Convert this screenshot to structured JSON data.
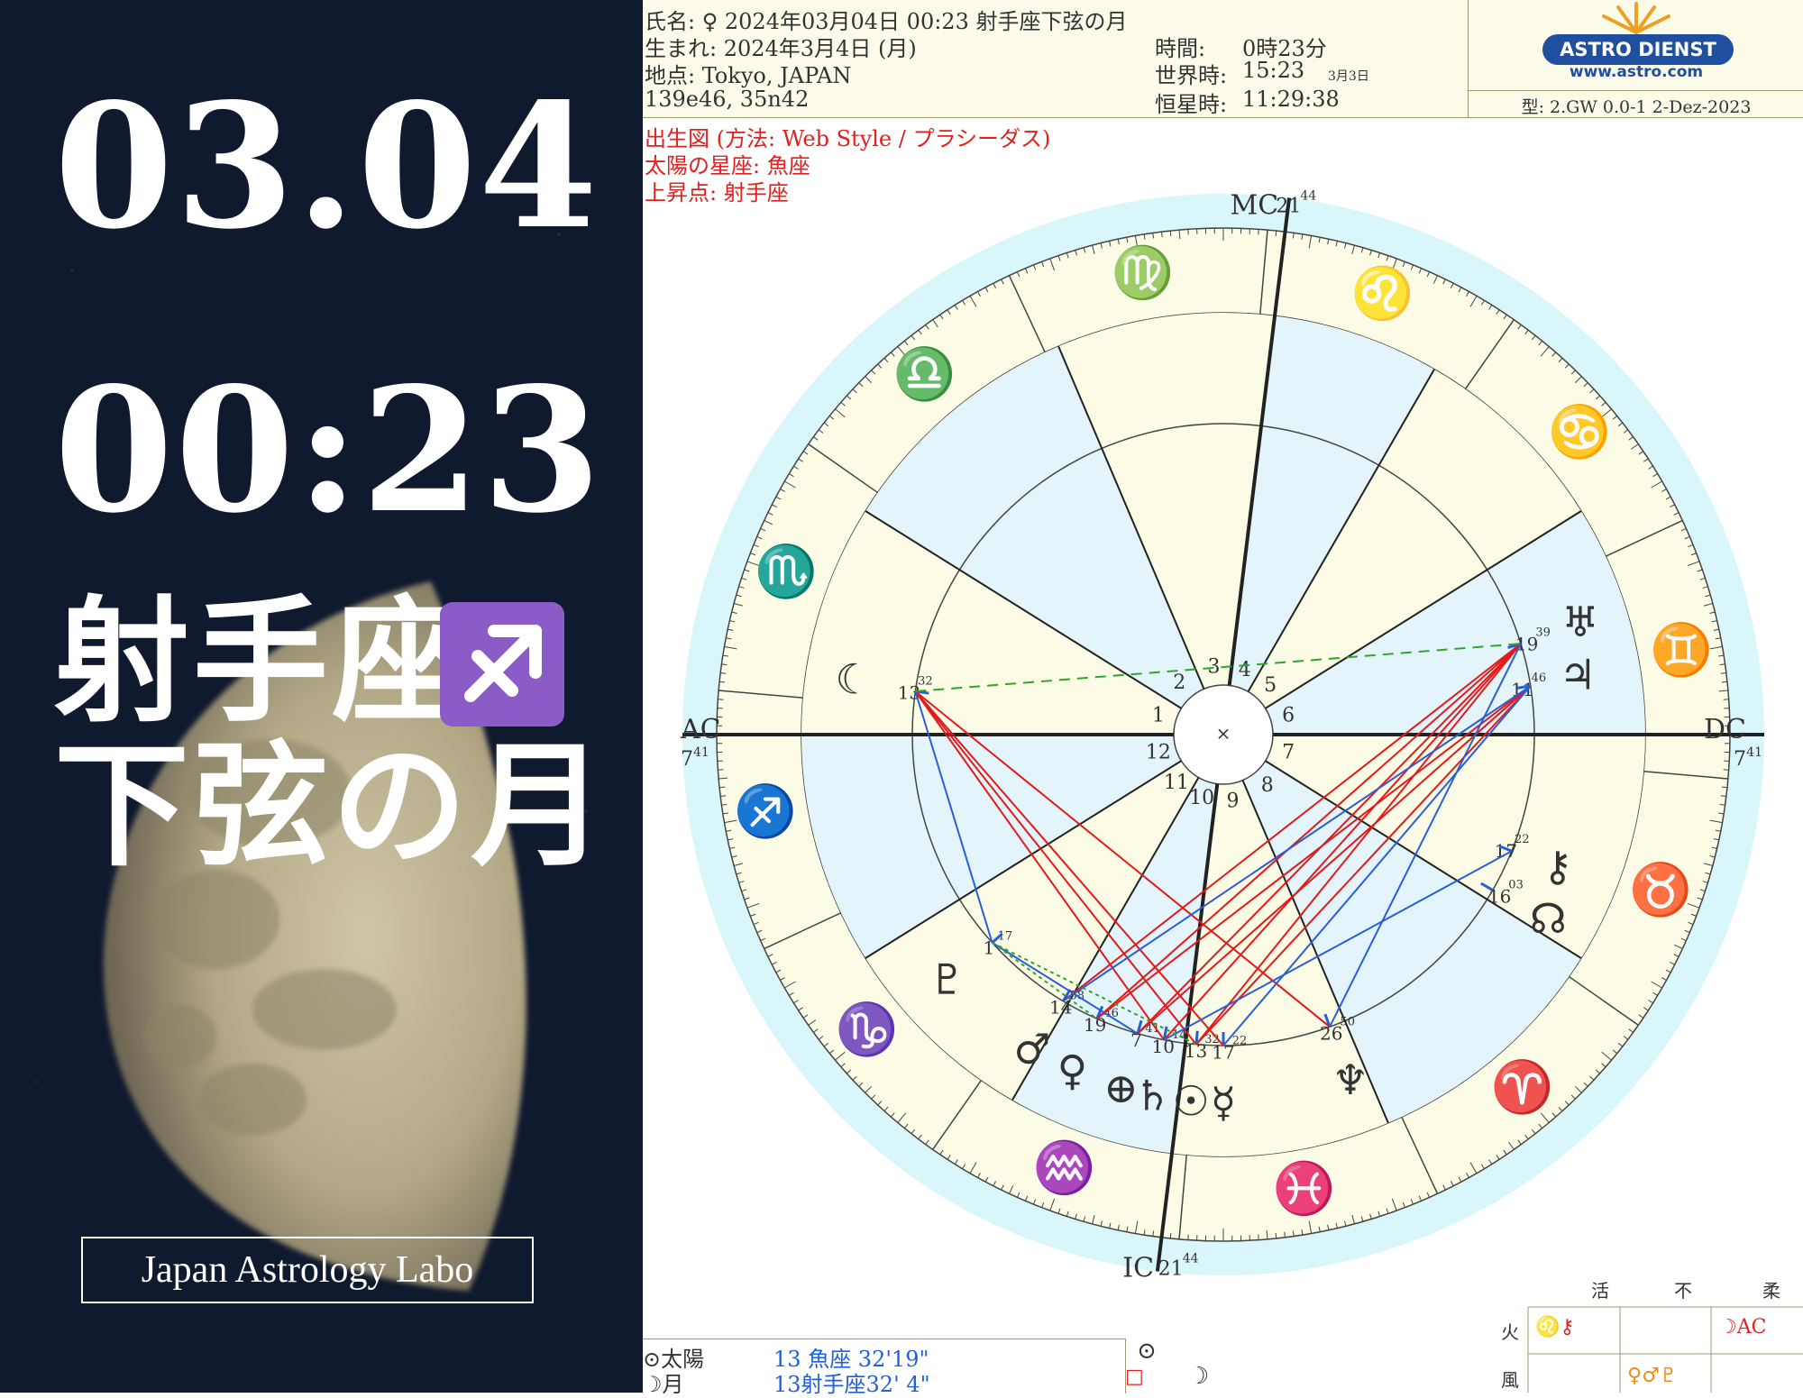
{
  "left_panel": {
    "date": "03.04",
    "time": "00:23",
    "sign": "射手座",
    "sign_symbol": "♐",
    "phase": "下弦の月",
    "brand": "Japan Astrology Labo"
  },
  "header": {
    "name_line": "氏名: ♀ 2024年03月04日 00:23 射手座下弦の月",
    "born_line": "生まれ: 2024年3月4日 (月)",
    "place_line": "地点: Tokyo, JAPAN",
    "coords_line": "139e46, 35n42",
    "time_label": "時間:",
    "time_value": "0時23分",
    "ut_label": "世界時:",
    "ut_value": "15:23",
    "ut_date": "3月3日",
    "st_label": "恒星時:",
    "st_value": "11:29:38",
    "logo_text": "ASTRO DIENST",
    "logo_url": "www.astro.com",
    "version": "型: 2.GW  0.0-1  2-Dez-2023",
    "chart_type": "出生図 (方法: Web Style / プラシーダス)",
    "sun_sign": "太陽の星座: 魚座",
    "ascendant": "上昇点: 射手座"
  },
  "wheel": {
    "mc": "MC",
    "mc_deg": "21",
    "mc_min": "44",
    "ic": "IC",
    "ic_deg": "21",
    "ic_min": "44",
    "ac": "AC",
    "ac_deg": "7",
    "ac_min": "41",
    "dc": "DC",
    "dc_deg": "7",
    "dc_min": "41",
    "center": "×",
    "houses": [
      "1",
      "2",
      "3",
      "4",
      "5",
      "6",
      "7",
      "8",
      "9",
      "10",
      "11",
      "12"
    ],
    "colors": {
      "outer_ring": "#d9f6fb",
      "zodiac_band": "#fcfbe6",
      "house_fill_a": "#e4f4fb",
      "house_fill_b": "#fcfbe6",
      "aspect_hard": "#e21a1a",
      "aspect_soft": "#2a5ed9",
      "aspect_minor": "#2fa52f"
    }
  },
  "zodiac": [
    {
      "name": "virgo",
      "glyph": "♍",
      "color": "#1aa51a"
    },
    {
      "name": "leo",
      "glyph": "♌",
      "color": "#e12020"
    },
    {
      "name": "cancer",
      "glyph": "♋",
      "color": "#2060d8"
    },
    {
      "name": "gemini",
      "glyph": "♊",
      "color": "#f08a1a"
    },
    {
      "name": "taurus",
      "glyph": "♉",
      "color": "#1aa51a"
    },
    {
      "name": "aries",
      "glyph": "♈",
      "color": "#e12020"
    },
    {
      "name": "pisces",
      "glyph": "♓",
      "color": "#2060d8"
    },
    {
      "name": "aquarius",
      "glyph": "♒",
      "color": "#f08a1a"
    },
    {
      "name": "capricorn",
      "glyph": "♑",
      "color": "#1aa51a"
    },
    {
      "name": "sagittarius",
      "glyph": "♐",
      "color": "#e12020"
    },
    {
      "name": "scorpio",
      "glyph": "♏",
      "color": "#2060d8"
    },
    {
      "name": "libra",
      "glyph": "♎",
      "color": "#f08a1a"
    }
  ],
  "planets": [
    {
      "name": "moon",
      "glyph": "☾",
      "deg": "13",
      "min": "32"
    },
    {
      "name": "uranus",
      "glyph": "♅",
      "deg": "19",
      "min": "39"
    },
    {
      "name": "jupiter",
      "glyph": "♃",
      "deg": "11",
      "min": "46"
    },
    {
      "name": "chiron",
      "glyph": "⚷",
      "deg": "17",
      "min": "22"
    },
    {
      "name": "node",
      "glyph": "☊",
      "deg": "16",
      "min": "03"
    },
    {
      "name": "neptune",
      "glyph": "♆",
      "deg": "26",
      "min": "50"
    },
    {
      "name": "mercury",
      "glyph": "☿",
      "deg": "17",
      "min": "22"
    },
    {
      "name": "sun",
      "glyph": "☉",
      "deg": "13",
      "min": "32"
    },
    {
      "name": "saturn",
      "glyph": "♄",
      "deg": "10",
      "min": "14"
    },
    {
      "name": "earth",
      "glyph": "⊕",
      "deg": "7",
      "min": "41"
    },
    {
      "name": "venus",
      "glyph": "♀",
      "deg": "19",
      "min": "46"
    },
    {
      "name": "mars",
      "glyph": "♂",
      "deg": "14",
      "min": "58"
    },
    {
      "name": "pluto",
      "glyph": "♇",
      "deg": "1",
      "min": "17"
    }
  ],
  "positions": {
    "sun_label": "⊙太陽",
    "sun_value": "13 魚座 32'19\"",
    "moon_label": "☽月",
    "moon_value": "13射手座32' 4\"",
    "sun_symbol": "⊙",
    "moon_symbol": "☽",
    "aspect_symbol": "□"
  },
  "element_table": {
    "headers": [
      "活",
      "不",
      "柔"
    ],
    "rows": [
      "火",
      "風"
    ],
    "fire_cardinal": "♌⚷",
    "fire_mutable": "☽AC",
    "air_fixed": "♀♂♇"
  }
}
